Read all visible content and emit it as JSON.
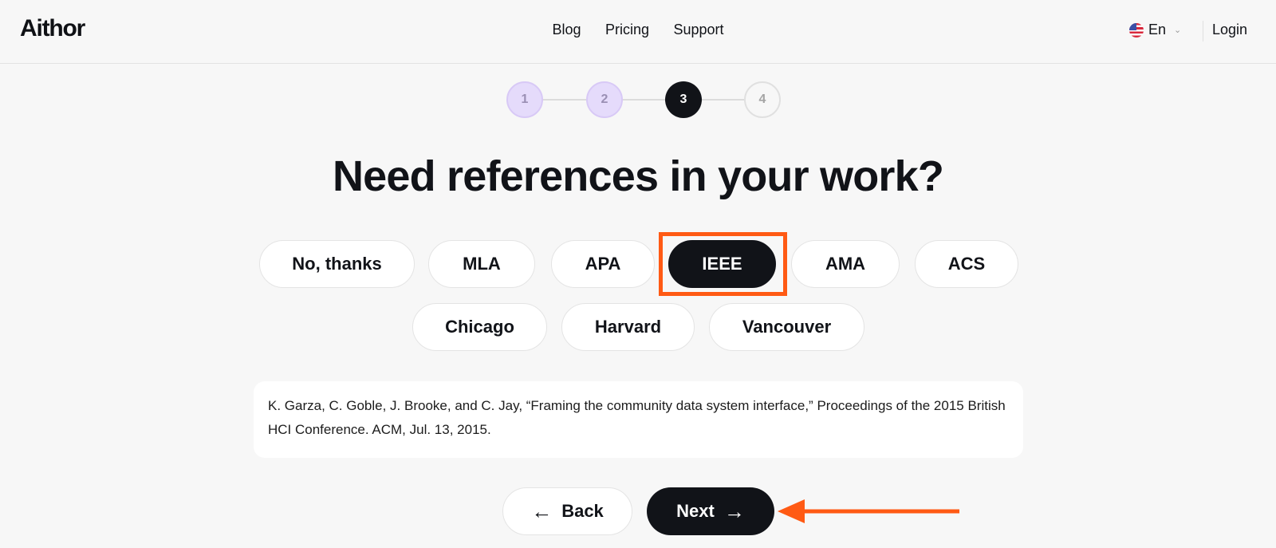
{
  "header": {
    "logo": "Aithor",
    "nav": [
      "Blog",
      "Pricing",
      "Support"
    ],
    "language": "En",
    "login": "Login"
  },
  "steps": [
    {
      "label": "1",
      "state": "done"
    },
    {
      "label": "2",
      "state": "done"
    },
    {
      "label": "3",
      "state": "active"
    },
    {
      "label": "4",
      "state": "todo"
    }
  ],
  "title": "Need references in your work?",
  "styles": {
    "row1": [
      "No, thanks",
      "MLA",
      "APA",
      "IEEE",
      "AMA",
      "ACS"
    ],
    "row2": [
      "Chicago",
      "Harvard",
      "Vancouver"
    ],
    "selected": "IEEE"
  },
  "citation": "K. Garza, C. Goble, J. Brooke, and C. Jay, “Framing the community data system interface,” Proceedings of the 2015 British HCI Conference. ACM, Jul. 13, 2015.",
  "buttons": {
    "back": "Back",
    "next": "Next"
  },
  "colors": {
    "accent": "#ff5a14",
    "dark": "#111318",
    "step_done": "#e5dbfb"
  }
}
